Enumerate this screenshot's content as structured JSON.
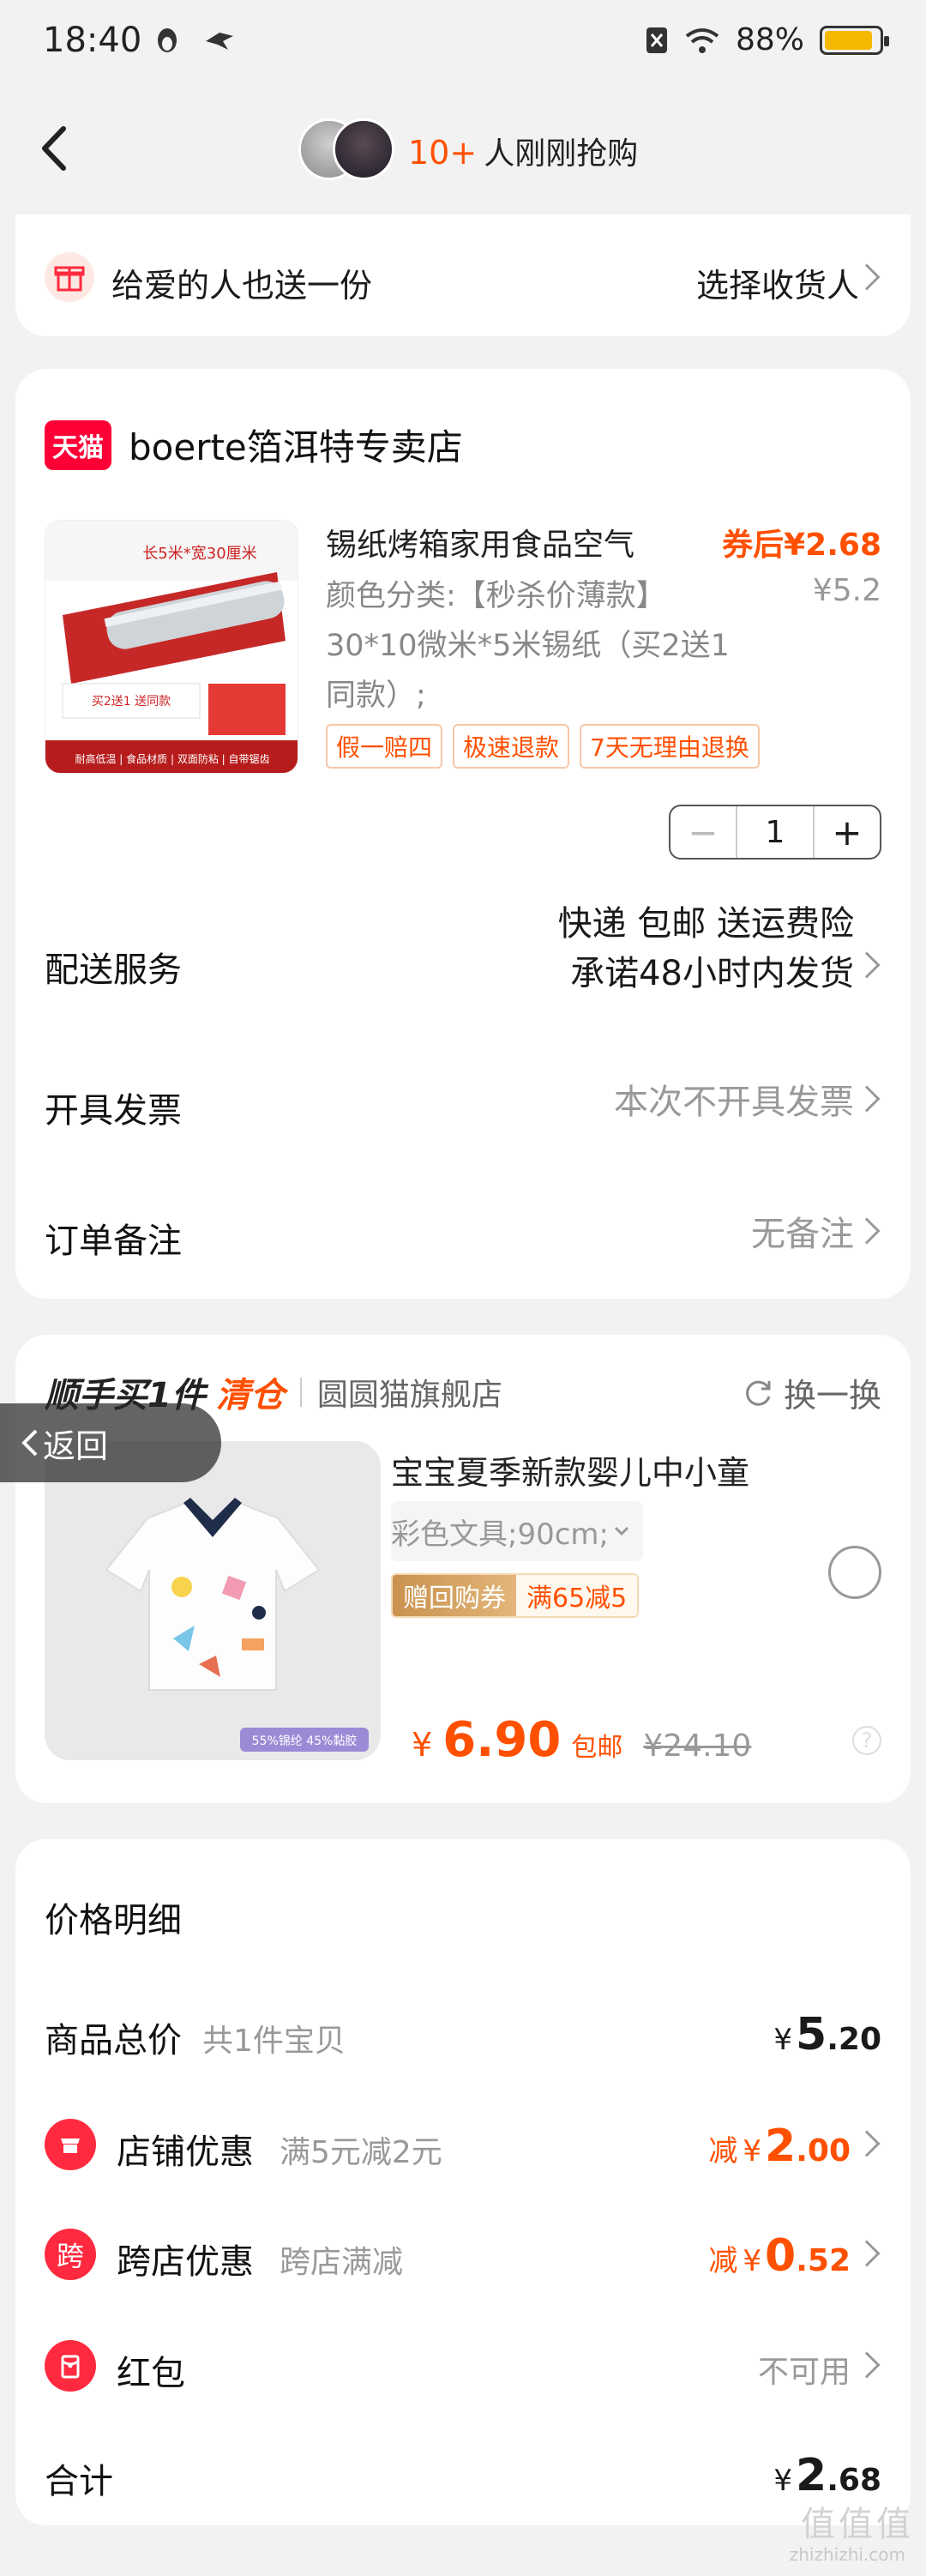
{
  "status_bar": {
    "time": "18:40",
    "battery": "88%",
    "battery_level": 0.88
  },
  "nav": {
    "count": "10+",
    "text": "人刚刚抢购"
  },
  "gift": {
    "text": "给爱的人也送一份",
    "action": "选择收货人"
  },
  "shop": {
    "logo_text": "天猫",
    "name": "boerte箔洱特专卖店",
    "product": {
      "title": "锡纸烤箱家用食品空气",
      "price_after": "券后¥2.68",
      "price_orig": "¥5.2",
      "sku": "颜色分类:【秒杀价薄款】30*10微米*5米锡纸（买2送1同款）;",
      "tags": [
        "假一赔四",
        "极速退款",
        "7天无理由退换"
      ],
      "image_text_top": "长5米*宽30厘米",
      "image_text_buy": "买2送1 送同款",
      "image_text_bottom": "耐高低温 | 食品材质 | 双面防粘 | 自带锯齿"
    },
    "quantity": "1",
    "delivery_label": "配送服务",
    "delivery_value_1": "快递 包邮 送运费险",
    "delivery_value_2": "承诺48小时内发货",
    "invoice_label": "开具发票",
    "invoice_value": "本次不开具发票",
    "note_label": "订单备注",
    "note_value": "无备注"
  },
  "addon": {
    "head_1": "顺手买1件",
    "head_2": "清仓",
    "store": "圆圆猫旗舰店",
    "swap": "换一换",
    "back": "返回",
    "title": "宝宝夏季新款婴儿中小童",
    "sku": "彩色文具;90cm;",
    "coupon_a": "赠回购券",
    "coupon_b": "满65减5",
    "price_symbol": "¥",
    "price": "6.90",
    "free_ship": "包邮",
    "orig_price": "¥24.10",
    "material": "55%锦纶 45%黏胶"
  },
  "price": {
    "title": "价格明细",
    "total_label": "商品总价",
    "total_sub": "共1件宝贝",
    "total_int": "5",
    "total_dec": ".20",
    "shop_disc_label": "店铺优惠",
    "shop_disc_sub": "满5元减2元",
    "shop_disc_prefix": "减",
    "shop_disc_int": "2",
    "shop_disc_dec": ".00",
    "cross_label": "跨店优惠",
    "cross_icon": "跨",
    "cross_sub": "跨店满减",
    "cross_prefix": "减",
    "cross_int": "0",
    "cross_dec": ".52",
    "hongbao_label": "红包",
    "hongbao_value": "不可用",
    "sum_label": "合计",
    "sum_int": "2",
    "sum_dec": ".68",
    "yen": "¥"
  },
  "watermark": {
    "main": "值值值",
    "sub": "zhizhizhi.com"
  },
  "colors": {
    "accent": "#ff5000",
    "tmall": "#ff0036",
    "background": "#f2f2f2"
  },
  "icons": [
    "back-arrow-icon",
    "gift-icon",
    "refresh-icon",
    "store-icon",
    "red-envelope-icon",
    "chevron-right-icon"
  ]
}
